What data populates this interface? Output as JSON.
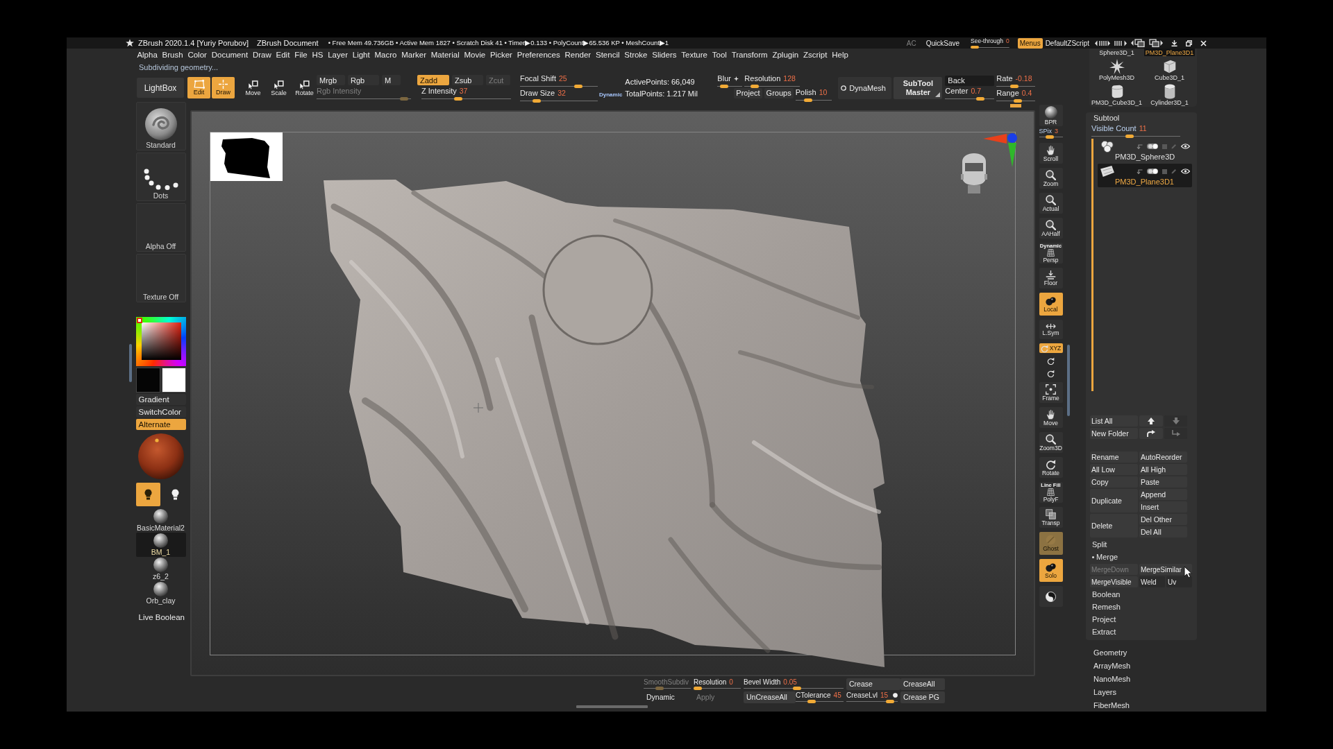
{
  "window": {
    "title": "ZBrush 2020.1.4 [Yuriy Porubov]",
    "document": "ZBrush Document",
    "stats": "• Free Mem 49.736GB • Active Mem 1827 • Scratch Disk 41 • Timer▶0.133 • PolyCount▶65.536 KP • MeshCount▶1",
    "title_buttons": [
      {
        "label": "AC",
        "disabled": true
      },
      {
        "label": "QuickSave",
        "disabled": false
      }
    ],
    "see_through": {
      "label": "See-through",
      "value": "0",
      "level": 0
    },
    "menus": {
      "label": "Menus",
      "on": true
    },
    "script": "DefaultZScript"
  },
  "menu": [
    "Alpha",
    "Brush",
    "Color",
    "Document",
    "Draw",
    "Edit",
    "File",
    "HS",
    "Layer",
    "Light",
    "Macro",
    "Marker",
    "Material",
    "Movie",
    "Picker",
    "Preferences",
    "Render",
    "Stencil",
    "Stroke",
    "Sliders",
    "Texture",
    "Tool",
    "Transform",
    "Zplugin",
    "Zscript",
    "Help"
  ],
  "status": "Subdividing geometry...",
  "toolbar": {
    "lightbox": "LightBox",
    "transform_modes": [
      {
        "kind": "edit",
        "label": "Edit",
        "on": true
      },
      {
        "kind": "draw",
        "label": "Draw",
        "on": true
      },
      {
        "kind": "move",
        "label": "Move",
        "on": false
      },
      {
        "kind": "scale",
        "label": "Scale",
        "on": false
      },
      {
        "kind": "rotate",
        "label": "Rotate",
        "on": false
      }
    ],
    "color_modes": [
      {
        "label": "Mrgb",
        "on": false
      },
      {
        "label": "Rgb",
        "on": false
      },
      {
        "label": "M",
        "on": false
      }
    ],
    "rgb_intensity": {
      "label": "Rgb Intensity",
      "disabled": true,
      "level": 0.97
    },
    "z_modes": [
      {
        "label": "Zadd",
        "on": true,
        "disabled": false
      },
      {
        "label": "Zsub",
        "on": false,
        "disabled": false
      },
      {
        "label": "Zcut",
        "on": false,
        "disabled": true
      }
    ],
    "z_intensity": {
      "label": "Z Intensity",
      "value": "37",
      "level": 0.4
    },
    "focal_shift": {
      "label": "Focal Shift",
      "value": "25",
      "level": 0.78
    },
    "draw_size": {
      "label": "Draw Size",
      "value": "32",
      "level": 0.18
    },
    "dynamic": "Dynamic",
    "points": [
      "ActivePoints: 66,049",
      "TotalPoints: 1.217 Mil"
    ]
  },
  "dynamesh": {
    "blur": {
      "label": "Blur",
      "level": 0.15
    },
    "resolution": {
      "label": "Resolution",
      "value": "128",
      "level": 0.12
    },
    "project": "Project",
    "groups": "Groups",
    "polish": {
      "label": "Polish",
      "value": "10",
      "level": 0.3
    },
    "dynamesh": {
      "label": "DynaMesh",
      "on": false
    },
    "subtool_master": "SubTool Master",
    "back": "Back",
    "center": {
      "label": "Center",
      "value": "0.7",
      "level": 0.75
    },
    "rate": {
      "label": "Rate",
      "value": "-0.18",
      "level": 0.45
    },
    "range": {
      "label": "Range",
      "value": "0.4",
      "level": 0.55
    }
  },
  "left_shelf": {
    "thumbnails": [
      {
        "kind": "brush",
        "label": "Standard"
      },
      {
        "kind": "stroke",
        "label": "Dots"
      },
      {
        "kind": "empty",
        "label": "Alpha Off"
      },
      {
        "kind": "empty",
        "label": "Texture Off"
      }
    ],
    "swatches": [
      {
        "color": "#050505"
      },
      {
        "color": "#ffffff"
      }
    ],
    "color_buttons": [
      {
        "label": "Gradient",
        "on": false
      },
      {
        "label": "SwitchColor",
        "on": false
      },
      {
        "label": "Alternate",
        "on": true
      }
    ],
    "lights": [
      {
        "on": true
      },
      {
        "on": false
      }
    ],
    "materials": [
      {
        "label": "BasicMaterial2",
        "selected": false
      },
      {
        "label": "BM_1",
        "selected": true
      },
      {
        "label": "z6_2",
        "selected": false
      },
      {
        "label": "Orb_clay",
        "selected": false
      }
    ],
    "live_boolean": "Live Boolean"
  },
  "right_shelf": {
    "bpr": "BPR",
    "spix": {
      "label": "SPix",
      "value": "3",
      "level": 0.45
    },
    "buttons": [
      {
        "kind": "scroll",
        "label": "Scroll",
        "on": false,
        "disabled": false
      },
      {
        "kind": "zoom",
        "label": "Zoom",
        "on": false,
        "disabled": false
      },
      {
        "kind": "actual",
        "label": "Actual",
        "on": false,
        "disabled": false
      },
      {
        "kind": "aahalf",
        "label": "AAHalf",
        "on": false,
        "disabled": false
      },
      {
        "kind": "persp",
        "label": "Persp",
        "caption": "Dynamic",
        "on": false,
        "disabled": false
      },
      {
        "kind": "floor",
        "label": "Floor",
        "on": false,
        "disabled": false
      },
      {
        "kind": "local",
        "label": "Local",
        "on": true,
        "disabled": false
      },
      {
        "kind": "lsym",
        "label": "L.Sym",
        "on": false,
        "disabled": false
      },
      {
        "kind": "xyz",
        "label": "XYZ",
        "on": true,
        "disabled": false
      },
      {
        "kind": "roty",
        "on": false,
        "disabled": false
      },
      {
        "kind": "rotz",
        "on": false,
        "disabled": false
      },
      {
        "kind": "frame",
        "label": "Frame",
        "on": false,
        "disabled": false
      },
      {
        "kind": "move",
        "label": "Move",
        "on": false,
        "disabled": false
      },
      {
        "kind": "zoom3d",
        "label": "Zoom3D",
        "on": false,
        "disabled": false
      },
      {
        "kind": "rotate",
        "label": "Rotate",
        "on": false,
        "disabled": false
      },
      {
        "kind": "polyf",
        "label": "PolyF",
        "caption": "Line Fill",
        "on": false,
        "disabled": false
      },
      {
        "kind": "transp",
        "label": "Transp",
        "on": false,
        "disabled": false
      },
      {
        "kind": "ghost",
        "label": "Ghost",
        "on": true,
        "disabled": true
      },
      {
        "kind": "solo",
        "label": "Solo",
        "on": true,
        "disabled": false
      },
      {
        "kind": "spotlight",
        "on": false,
        "disabled": false
      }
    ]
  },
  "tools": [
    {
      "kind": "none",
      "label": "Sphere3D_1",
      "selected": false
    },
    {
      "kind": "none",
      "label": "PM3D_Plane3D1",
      "selected": true
    },
    {
      "kind": "star",
      "label": "PolyMesh3D",
      "selected": false
    },
    {
      "kind": "cube",
      "label": "Cube3D_1",
      "selected": false
    },
    {
      "kind": "softcube",
      "label": "PM3D_Cube3D_1",
      "selected": false
    },
    {
      "kind": "cylinder",
      "label": "Cylinder3D_1",
      "selected": false
    }
  ],
  "subtool": {
    "title": "Subtool",
    "visible_count": {
      "label": "Visible Count",
      "value": "11",
      "level": 0.42
    },
    "items": [
      {
        "kind": "spheres",
        "name": "PM3D_Sphere3D",
        "selected": false
      },
      {
        "kind": "cloth",
        "name": "PM3D_Plane3D1",
        "selected": true
      }
    ],
    "list_row": [
      {
        "kind": "text",
        "label": "List All",
        "disabled": false
      },
      {
        "kind": "up",
        "disabled": false
      },
      {
        "kind": "down",
        "disabled": true
      }
    ],
    "folder_row": [
      {
        "kind": "text",
        "label": "New Folder",
        "disabled": false
      },
      {
        "kind": "folder",
        "disabled": false
      },
      {
        "kind": "right",
        "disabled": true
      }
    ],
    "actions": [
      {
        "label": "Rename",
        "pair": [
          "AutoReorder"
        ]
      },
      {
        "label": "All Low",
        "pair": [
          "All High"
        ]
      },
      {
        "label": "Copy",
        "pair": [
          "Paste"
        ]
      },
      {
        "label": "Duplicate",
        "pair": [
          "Append",
          "Insert"
        ]
      },
      {
        "label": "Delete",
        "pair": [
          "Del Other",
          "Del All"
        ]
      }
    ],
    "sections": [
      {
        "label": "Split",
        "expanded": false
      },
      {
        "label": "Merge",
        "expanded": true,
        "rows": [
          [
            {
              "label": "MergeDown",
              "disabled": true
            },
            {
              "label": "MergeSimilar",
              "disabled": false
            }
          ],
          [
            {
              "label": "MergeVisible",
              "disabled": false
            },
            {
              "label": "Weld",
              "disabled": false
            },
            {
              "label": "Uv",
              "disabled": false
            }
          ]
        ]
      },
      {
        "label": "Boolean",
        "expanded": false
      },
      {
        "label": "Remesh",
        "expanded": false
      },
      {
        "label": "Project",
        "expanded": false
      },
      {
        "label": "Extract",
        "expanded": false
      }
    ]
  },
  "palettes": [
    "Geometry",
    "ArrayMesh",
    "NanoMesh",
    "Layers",
    "FiberMesh"
  ],
  "bottom_bar": {
    "rows": [
      [
        {
          "kind": "slider",
          "label": "SmoothSubdiv",
          "disabled": true,
          "level": 0.3
        },
        {
          "kind": "slider",
          "label": "Resolution",
          "value": "0",
          "disabled": false,
          "level": 0
        },
        {
          "kind": "slider",
          "label": "Bevel Width",
          "value": "0.05",
          "disabled": false,
          "level": 0.54,
          "colspan": 2
        },
        {
          "kind": "button",
          "label": "Crease",
          "disabled": false
        },
        {
          "kind": "button",
          "label": "CreaseAll",
          "disabled": false
        }
      ],
      [
        {
          "kind": "plain",
          "label": "Dynamic",
          "disabled": false
        },
        {
          "kind": "plain",
          "label": "Apply",
          "disabled": true
        },
        {
          "kind": "button",
          "label": "UnCreaseAll",
          "disabled": false
        },
        {
          "kind": "slider",
          "label": "CTolerance",
          "value": "45",
          "disabled": false,
          "level": 0.3
        },
        {
          "kind": "slider",
          "label": "CreaseLvl",
          "value": "15",
          "disabled": false,
          "level": 0.92,
          "switch_on": true
        },
        {
          "kind": "button",
          "label": "Crease PG",
          "disabled": false
        }
      ]
    ]
  }
}
